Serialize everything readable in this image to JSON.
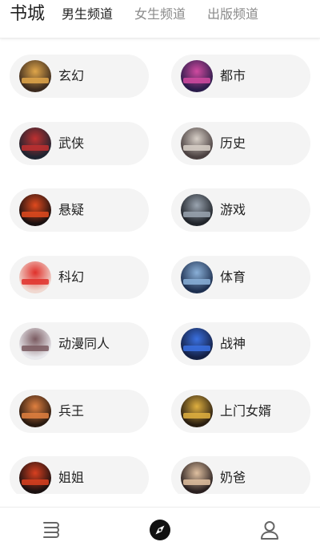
{
  "header": {
    "title": "书城",
    "tabs": [
      {
        "label": "男生频道",
        "active": true
      },
      {
        "label": "女生频道",
        "active": false
      },
      {
        "label": "出版频道",
        "active": false
      }
    ]
  },
  "categories": [
    {
      "label": "玄幻",
      "cover_colors": [
        "#3b2a1e",
        "#e0a64a"
      ]
    },
    {
      "label": "都市",
      "cover_colors": [
        "#2a1b4a",
        "#d04aa0"
      ]
    },
    {
      "label": "武侠",
      "cover_colors": [
        "#1e2430",
        "#c03030"
      ]
    },
    {
      "label": "历史",
      "cover_colors": [
        "#4a4040",
        "#d8d0c8"
      ]
    },
    {
      "label": "悬疑",
      "cover_colors": [
        "#1a1010",
        "#e04a1e"
      ]
    },
    {
      "label": "游戏",
      "cover_colors": [
        "#20242a",
        "#9aa4b0"
      ]
    },
    {
      "label": "科幻",
      "cover_colors": [
        "#f0d8d0",
        "#e0302a"
      ]
    },
    {
      "label": "体育",
      "cover_colors": [
        "#1e3050",
        "#8ab0d8"
      ]
    },
    {
      "label": "动漫同人",
      "cover_colors": [
        "#e8e8ec",
        "#7a5a60"
      ]
    },
    {
      "label": "战神",
      "cover_colors": [
        "#142044",
        "#3a70e0"
      ]
    },
    {
      "label": "兵王",
      "cover_colors": [
        "#2a1a10",
        "#e08040"
      ]
    },
    {
      "label": "上门女婿",
      "cover_colors": [
        "#2a1e10",
        "#e0b040"
      ]
    },
    {
      "label": "姐姐",
      "cover_colors": [
        "#1a1010",
        "#d84020"
      ]
    },
    {
      "label": "奶爸",
      "cover_colors": [
        "#2a2020",
        "#e0c0a0"
      ]
    }
  ],
  "bottom_nav": {
    "items": [
      {
        "icon": "bookshelf-icon",
        "active": false
      },
      {
        "icon": "compass-icon",
        "active": true
      },
      {
        "icon": "user-icon",
        "active": false
      }
    ]
  }
}
